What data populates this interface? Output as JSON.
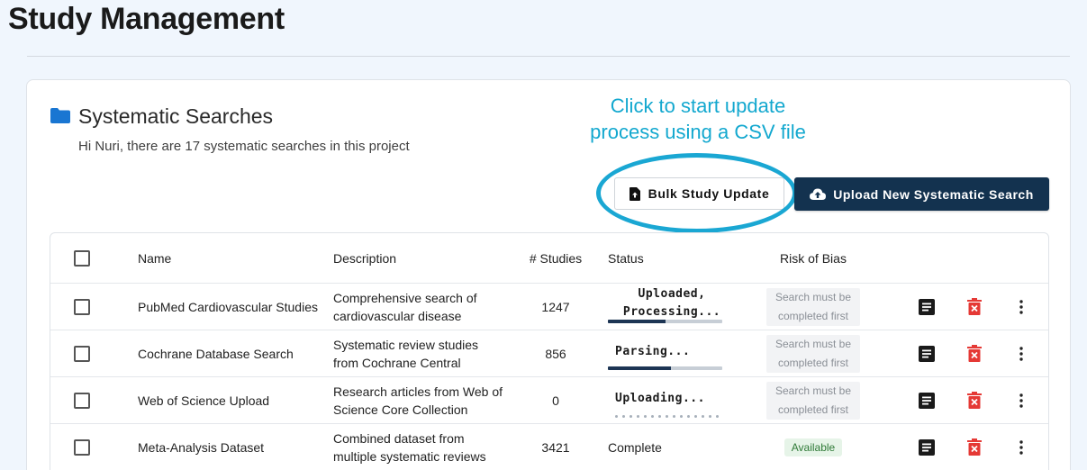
{
  "page": {
    "title": "Study Management"
  },
  "card": {
    "title": "Systematic Searches",
    "subtitle": "Hi Nuri, there are 17 systematic searches in this project",
    "folder_icon": "folder-icon"
  },
  "callout": {
    "line1": "Click to start update",
    "line2": "process using a CSV file",
    "color": "#13a8cf"
  },
  "actions": {
    "bulk_update_label": "Bulk Study Update",
    "bulk_update_icon": "file-upload-icon",
    "upload_label": "Upload New Systematic Search",
    "upload_icon": "cloud-upload-icon",
    "primary_color": "#13324f"
  },
  "table": {
    "headers": {
      "name": "Name",
      "description": "Description",
      "studies": "# Studies",
      "status": "Status",
      "rob": "Risk of Bias"
    },
    "rows": [
      {
        "name": "PubMed Cardiovascular Studies",
        "description": "Comprehensive search of cardiovascular disease",
        "studies": "1247",
        "status": "Uploaded, Processing...",
        "status_kind": "progress",
        "progress": 0.5,
        "rob": "Search must be completed first"
      },
      {
        "name": "Cochrane Database Search",
        "description": "Systematic review studies from Cochrane Central",
        "studies": "856",
        "status": "Parsing...",
        "status_kind": "progress",
        "progress": 0.55,
        "rob": "Search must be completed first"
      },
      {
        "name": "Web of Science Upload",
        "description": "Research articles from Web of Science Core Collection",
        "studies": "0",
        "status": "Uploading...",
        "status_kind": "buffer",
        "rob": "Search must be completed first"
      },
      {
        "name": "Meta-Analysis Dataset",
        "description": "Combined dataset from multiple systematic reviews",
        "studies": "3421",
        "status": "Complete",
        "status_kind": "complete",
        "rob": "Available"
      }
    ],
    "row_icons": [
      "document-icon",
      "delete-icon",
      "more-vert-icon"
    ]
  }
}
